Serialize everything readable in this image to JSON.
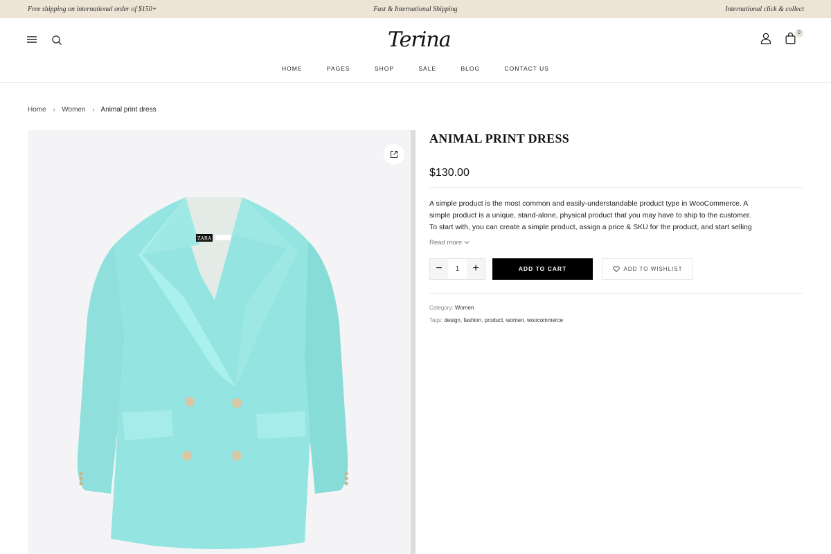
{
  "topbar": {
    "left": "Free shipping on international order of $150+",
    "center": "Fast & International Shipping",
    "right": "International click & collect"
  },
  "header": {
    "logo": "Terina",
    "cart_count": "0",
    "icons": [
      "menu-icon",
      "search-icon",
      "account-icon",
      "cart-icon"
    ]
  },
  "nav": {
    "items": [
      "HOME",
      "PAGES",
      "SHOP",
      "SALE",
      "BLOG",
      "CONTACT US"
    ]
  },
  "breadcrumb": {
    "home": "Home",
    "category": "Women",
    "current": "Animal print dress"
  },
  "gallery": {
    "label_text": "ZARA"
  },
  "product": {
    "title": "ANIMAL PRINT DRESS",
    "price": "$130.00",
    "description_lines": [
      "A simple product is the most common and easily-understandable product type in WooCommerce. A",
      "simple product is a unique, stand-alone, physical product that you may have to ship to the customer.",
      "To start with, you can create a simple product, assign a price & SKU for the product, and start selling"
    ],
    "read_more": "Read more",
    "quantity": "1",
    "add_to_cart": "ADD TO CART",
    "add_to_wishlist": "ADD TO WISHLIST",
    "category_label": "Category:",
    "category_value": "Women",
    "tags_label": "Tags:",
    "tags": [
      "design",
      "fashion",
      "product",
      "women",
      "woocommerce"
    ]
  },
  "colors": {
    "topbar_bg": "#ede4d6",
    "button_bg": "#000000",
    "jacket": "#8fe3df"
  }
}
